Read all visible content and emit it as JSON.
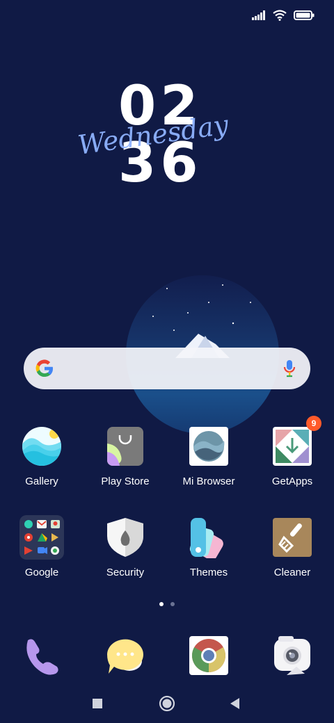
{
  "status_bar": {
    "icons": [
      "signal-icon",
      "wifi-icon",
      "battery-icon"
    ]
  },
  "clock": {
    "hours": "02",
    "minutes": "36",
    "day": "Wednesday"
  },
  "search_widget": {
    "logo": "google-g-icon",
    "mic": "microphone-icon"
  },
  "apps": [
    {
      "label": "Gallery",
      "icon": "gallery-icon"
    },
    {
      "label": "Play Store",
      "icon": "play-store-icon"
    },
    {
      "label": "Mi Browser",
      "icon": "mi-browser-icon"
    },
    {
      "label": "GetApps",
      "icon": "getapps-icon",
      "badge": "9"
    },
    {
      "label": "Google",
      "icon": "google-folder-icon"
    },
    {
      "label": "Security",
      "icon": "security-icon"
    },
    {
      "label": "Themes",
      "icon": "themes-icon"
    },
    {
      "label": "Cleaner",
      "icon": "cleaner-icon"
    }
  ],
  "page_indicator": {
    "pages": 2,
    "current": 1
  },
  "dock": [
    {
      "icon": "phone-icon"
    },
    {
      "icon": "messaging-icon"
    },
    {
      "icon": "chrome-icon"
    },
    {
      "icon": "camera-icon"
    }
  ],
  "navigation": [
    "recents-button",
    "home-button",
    "back-button"
  ],
  "colors": {
    "background": "#101a45",
    "badge": "#ff5a2a",
    "clock_script": "#8fb3ff"
  }
}
